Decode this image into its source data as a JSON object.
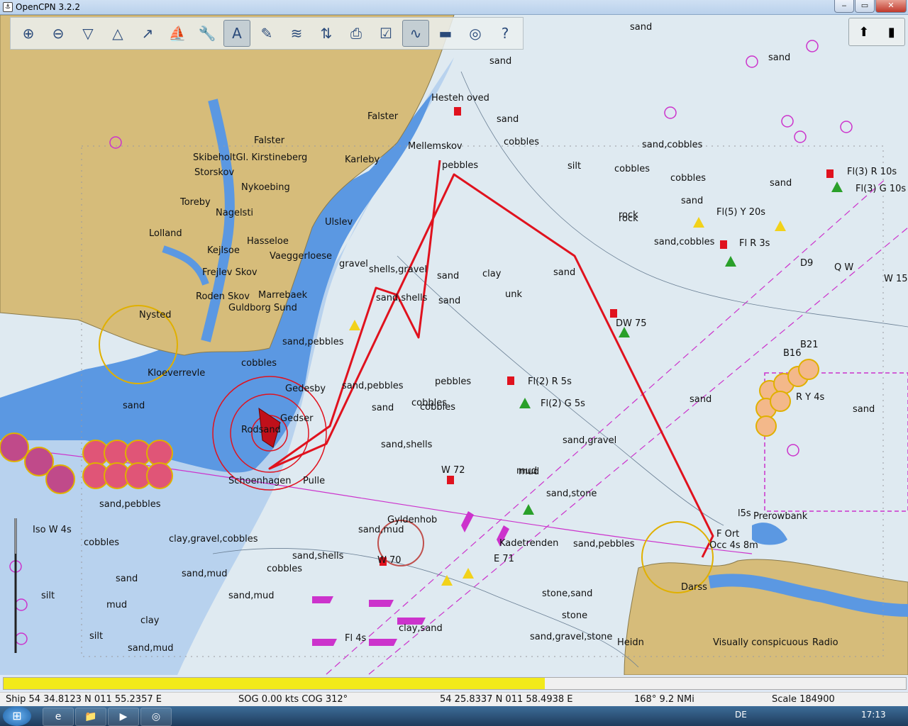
{
  "window": {
    "title": "OpenCPN 3.2.2",
    "minimize": "‒",
    "maximize": "▭",
    "close": "✕"
  },
  "toolbar": {
    "tools": [
      {
        "icon": "zoom-in-icon",
        "glyph": "⊕"
      },
      {
        "icon": "zoom-out-icon",
        "glyph": "⊖"
      },
      {
        "icon": "scale-in-icon",
        "glyph": "▽"
      },
      {
        "icon": "scale-out-icon",
        "glyph": "△"
      },
      {
        "icon": "route-icon",
        "glyph": "↗"
      },
      {
        "icon": "ship-icon",
        "glyph": "⛵"
      },
      {
        "icon": "settings-icon",
        "glyph": "🔧"
      },
      {
        "icon": "text-icon",
        "glyph": "A"
      },
      {
        "icon": "mark-icon",
        "glyph": "✎"
      },
      {
        "icon": "current-icon",
        "glyph": "≋"
      },
      {
        "icon": "tide-icon",
        "glyph": "⇅"
      },
      {
        "icon": "print-icon",
        "glyph": "⎙"
      },
      {
        "icon": "route-manager-icon",
        "glyph": "☑"
      },
      {
        "icon": "track-icon",
        "glyph": "∿"
      },
      {
        "icon": "color-scheme-icon",
        "glyph": "▬"
      },
      {
        "icon": "mob-icon",
        "glyph": "◎"
      },
      {
        "icon": "help-icon",
        "glyph": "?"
      }
    ]
  },
  "right_tools": [
    {
      "icon": "compass-icon",
      "glyph": "⬆"
    },
    {
      "icon": "gps-status-icon",
      "glyph": "▮"
    }
  ],
  "chart_labels": {
    "falster": "Falster",
    "falster2": "Falster",
    "hestehoved": "Hesteh oved",
    "mellemskov": "Mellemskov",
    "skibeholt": "SkibeholtGl. Kirstineberg",
    "storskov": "Storskov",
    "nykoebing": "Nykoebing",
    "karleby": "Karleby",
    "toreby": "Toreby",
    "nagelsti": "Nagelsti",
    "lolland": "Lolland",
    "ulslev": "Ulslev",
    "hasseloe": "Hasseloe",
    "kejlsoe": "Kejlsoe",
    "vaeggerloese": "Vaeggerloese",
    "frejlev": "Frejlev Skov",
    "roden": "Roden Skov",
    "marrebaek": "Marrebaek",
    "guldborg": "Guldborg Sund",
    "nysted": "Nysted",
    "kloeverrevle": "Kloeverrevle",
    "gedesby": "Gedesby",
    "gedser": "Gedser",
    "rodsand": "Rodsand",
    "schoenhagen": "Schoenhagen",
    "pulle": "Pulle",
    "gyldenhob": "Gyldenhob",
    "darss": "Darss",
    "prerowbank": "Prerowbank",
    "heidn": "Heidn",
    "visually": "Visually conspicuous",
    "radio": "Radio",
    "kadetrenden": "Kadetrenden",
    "fl3r": "Fl(3) R 10s",
    "fl3g": "Fl(3) G 10s",
    "fl5y": "Fl(5) Y 20s",
    "flr3s": "Fl R 3s",
    "d9": "D9",
    "qw": "Q W",
    "w15": "W 15",
    "dw75": "DW 75",
    "fl2r": "Fl(2) R 5s",
    "fl2g": "Fl(2) G 5s",
    "b21": "B21",
    "b16": "B16",
    "ry4s": "R Y 4s",
    "w72": "W 72",
    "w70": "W 70",
    "e71": "E 71",
    "fl4": "Fl 4s",
    "isow": "Iso W 4s",
    "occ": "Occ 4s 8m",
    "fort": "F Ort",
    "l5s": "l5s"
  },
  "seabed": [
    "sand",
    "sand",
    "sand",
    "sand",
    "pebbles",
    "cobbles",
    "silt",
    "rock",
    "sand,cobbles",
    "cobbles",
    "cobbles",
    "sand",
    "sand",
    "gravel",
    "shells,gravel",
    "sand,shells",
    "sand",
    "sand",
    "clay",
    "unk",
    "sand,cobbles",
    "sand",
    "sand,pebbles",
    "pebbles",
    "sand",
    "cobbles",
    "sand,shells",
    "sand,gravel",
    "sand",
    "mud",
    "sand,stone",
    "sand,pebbles",
    "sand,mud",
    "cobbles",
    "clay,gravel,cobbles",
    "sand,shells",
    "sand,pebbles",
    "sand,mud",
    "sand,mud",
    "clay",
    "silt",
    "mud",
    "sand,mud",
    "clay,sand",
    "sand,gravel,stone",
    "stone,sand",
    "stone",
    "sand",
    "cobbles",
    "rock",
    "sand,pebbles",
    "cobbles",
    "sand",
    "sand",
    "mud",
    "cobbles",
    "silt"
  ],
  "progress": {
    "fraction": 0.6
  },
  "status": {
    "ship": "Ship 54 34.8123 N   011 55.2357 E",
    "sog": "SOG 0.00 kts   COG 312°",
    "cursor": "54 25.8337 N   011 58.4938 E",
    "bearing": "168°   9.2 NMi",
    "scale": "Scale 184900"
  },
  "taskbar": {
    "lang": "DE",
    "time": "17:13",
    "start": "⊞",
    "tasks": [
      "e",
      "📁",
      "▶",
      "◎"
    ]
  },
  "colors": {
    "land": "#d6bc7a",
    "deep_water": "#e2eef4",
    "shallow_water": "#4d8fe0",
    "mid_water": "#a9c8ec",
    "route": "#e0121e",
    "accent": "#cc33cc"
  }
}
